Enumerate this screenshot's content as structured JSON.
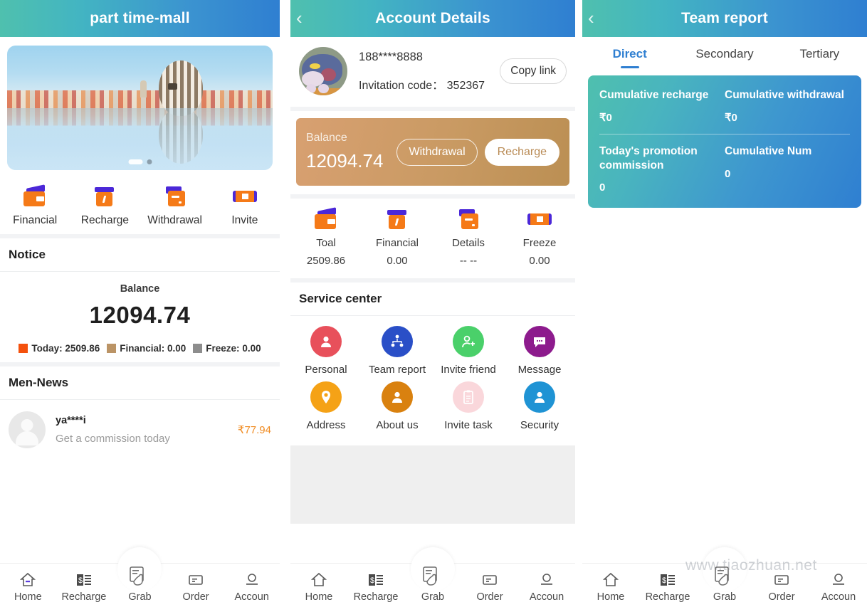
{
  "panels": {
    "home": {
      "title": "part time-mall",
      "banner": {
        "indicator_active": "slide-1",
        "indicator_count": 2
      },
      "quick_actions": [
        {
          "label": "Financial",
          "icon": "wallet-icon"
        },
        {
          "label": "Recharge",
          "icon": "recharge-card-icon"
        },
        {
          "label": "Withdrawal",
          "icon": "withdraw-card-icon"
        },
        {
          "label": "Invite",
          "icon": "coupon-percent-icon"
        }
      ],
      "notice_heading": "Notice",
      "balance": {
        "caption": "Balance",
        "amount": "12094.74",
        "legend": [
          {
            "label": "Today:",
            "value": "2509.86",
            "color": "#f4510d"
          },
          {
            "label": "Financial:",
            "value": "0.00",
            "color": "#bb9466"
          },
          {
            "label": "Freeze:",
            "value": "0.00",
            "color": "#8d8d8d"
          }
        ]
      },
      "news_heading": "Men-News",
      "news_items": [
        {
          "name": "ya****i",
          "subtitle": "Get a commission today",
          "amount": "₹77.94"
        }
      ]
    },
    "account": {
      "title": "Account Details",
      "back_icon": "chevron-left-icon",
      "profile": {
        "phone": "188****8888",
        "invitation_label": "Invitation code：",
        "invitation_code": "352367",
        "copy_button": "Copy link"
      },
      "balance_card": {
        "caption": "Balance",
        "amount": "12094.74",
        "withdrawal_button": "Withdrawal",
        "recharge_button": "Recharge"
      },
      "stats": [
        {
          "label": "Toal",
          "value": "2509.86",
          "icon": "wallet-icon"
        },
        {
          "label": "Financial",
          "value": "0.00",
          "icon": "recharge-card-icon"
        },
        {
          "label": "Details",
          "value": "-- --",
          "icon": "withdraw-card-icon"
        },
        {
          "label": "Freeze",
          "value": "0.00",
          "icon": "coupon-percent-icon"
        }
      ],
      "service_heading": "Service center",
      "services": [
        {
          "label": "Personal",
          "icon": "person-icon",
          "color": "#e8505b",
          "glyph": "●"
        },
        {
          "label": "Team report",
          "icon": "team-network-icon",
          "color": "#2a4fc7",
          "glyph": "●"
        },
        {
          "label": "Invite friend",
          "icon": "person-add-icon",
          "color": "#4ad06a",
          "glyph": "●"
        },
        {
          "label": "Message",
          "icon": "chat-bubble-icon",
          "color": "#8d1b8d",
          "glyph": "●"
        },
        {
          "label": "Address",
          "icon": "location-pin-icon",
          "color": "#f5a216",
          "glyph": "●"
        },
        {
          "label": "About us",
          "icon": "avatar-icon",
          "color": "#d9810f",
          "glyph": "●"
        },
        {
          "label": "Invite task",
          "icon": "clipboard-icon",
          "color": "#fad7db",
          "glyph": "●"
        },
        {
          "label": "Security",
          "icon": "shield-user-icon",
          "color": "#1f93d4",
          "glyph": "●"
        }
      ]
    },
    "team": {
      "title": "Team report",
      "back_icon": "chevron-left-icon",
      "tabs": [
        {
          "label": "Direct",
          "active": true
        },
        {
          "label": "Secondary",
          "active": false
        },
        {
          "label": "Tertiary",
          "active": false
        }
      ],
      "summary": [
        {
          "title": "Cumulative recharge",
          "value": "₹0"
        },
        {
          "title": "Cumulative withdrawal",
          "value": "₹0"
        },
        {
          "title": "Today's promotion commission",
          "value": "0"
        },
        {
          "title": "Cumulative Num",
          "value": "0"
        }
      ]
    }
  },
  "tabbar": {
    "items": [
      {
        "label": "Home",
        "icon": "home-icon",
        "active": true
      },
      {
        "label": "Recharge",
        "icon": "receipt-icon",
        "active": false
      },
      {
        "label": "Grab",
        "icon": "grab-hand-icon",
        "active": false
      },
      {
        "label": "Order",
        "icon": "order-icon",
        "active": false
      },
      {
        "label": "Accoun",
        "icon": "account-icon",
        "active": false
      }
    ]
  },
  "watermark": "www.tiaozhuan.net",
  "colors": {
    "header_gradient_start": "#4fc0ae",
    "header_gradient_end": "#2f7fd1",
    "accent_orange": "#f57a18",
    "accent_purple": "#4b28d8",
    "balance_card": "#c99a63",
    "tab_active": "#2f7fd1"
  }
}
